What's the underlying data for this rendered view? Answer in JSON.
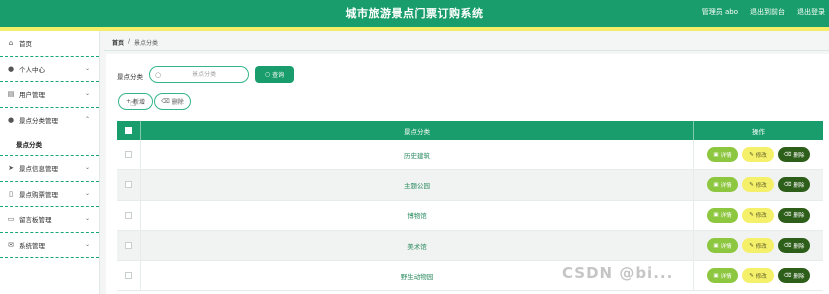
{
  "header": {
    "app_title": "城市旅游景点门票订购系统",
    "admin_label": "管理员 abo",
    "to_front_label": "退出到前台",
    "logout_label": "退出登录"
  },
  "sidebar": {
    "items": [
      {
        "label": "首页",
        "icon": "home-icon"
      },
      {
        "label": "个人中心",
        "icon": "user-icon"
      },
      {
        "label": "用户管理",
        "icon": "users-icon"
      },
      {
        "label": "景点分类管理",
        "icon": "category-icon"
      },
      {
        "label": "景点信息管理",
        "icon": "send-icon"
      },
      {
        "label": "景点购票管理",
        "icon": "ticket-icon"
      },
      {
        "label": "留言板管理",
        "icon": "message-icon"
      },
      {
        "label": "系统管理",
        "icon": "settings-icon"
      }
    ],
    "sub_item": "景点分类"
  },
  "breadcrumb": {
    "home": "首页",
    "separator": "/",
    "current": "景点分类"
  },
  "filter": {
    "label": "景点分类",
    "placeholder": "景点分类",
    "query_label": "查询"
  },
  "actions": {
    "add_label": "新增",
    "delete_label": "删除"
  },
  "table": {
    "headers": {
      "category": "景点分类",
      "operations": "操作"
    },
    "rows": [
      {
        "category": "历史建筑"
      },
      {
        "category": "主题公园"
      },
      {
        "category": "博物馆"
      },
      {
        "category": "美术馆"
      },
      {
        "category": "野生动物园"
      }
    ],
    "row_actions": {
      "detail": "详情",
      "edit": "修改",
      "delete": "删除"
    }
  },
  "watermark": "CSDN @bi..."
}
